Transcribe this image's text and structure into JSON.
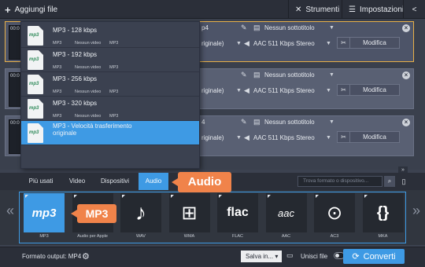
{
  "toolbar": {
    "add_files": "Aggiungi file",
    "tools": "Strumenti",
    "settings": "Impostazioni"
  },
  "files": [
    {
      "video": "p4",
      "subtitle": "Nessun sottotitolo",
      "audio_prefix": "riginale)",
      "audio": "AAC 511 Kbps Stereo",
      "edit": "Modifica"
    },
    {
      "video": "",
      "subtitle": "Nessun sottotitolo",
      "audio_prefix": "riginale)",
      "audio": "AAC 511 Kbps Stereo",
      "edit": "Modifica"
    },
    {
      "video": "4",
      "subtitle": "Nessun sottotitolo",
      "audio_prefix": "riginale)",
      "audio": "AAC 511 Kbps Stereo",
      "edit": "Modifica"
    }
  ],
  "thumb_time": "00:0",
  "dropdown": [
    {
      "title": "MP3 - 128 kbps",
      "ext": "MP3",
      "video": "Nessun video",
      "codec": "MP3",
      "icon": "mp3"
    },
    {
      "title": "MP3 - 192 kbps",
      "ext": "MP3",
      "video": "Nessun video",
      "codec": "MP3",
      "icon": "mp3"
    },
    {
      "title": "MP3 - 256 kbps",
      "ext": "MP3",
      "video": "Nessun video",
      "codec": "MP3",
      "icon": "mp3"
    },
    {
      "title": "MP3 - 320 kbps",
      "ext": "MP3",
      "video": "Nessun video",
      "codec": "MP3",
      "icon": "mp3"
    },
    {
      "title": "MP3 - Velocità trasferimento originale",
      "ext": "MP3",
      "video": "Nessun video",
      "codec": "MP3",
      "icon": "mp3",
      "active": true
    }
  ],
  "tabs": [
    "Più usati",
    "Video",
    "Dispositivi",
    "Audio"
  ],
  "search_placeholder": "Trova formato o dispositivo...",
  "callouts": {
    "audio": "Audio",
    "mp3": "MP3"
  },
  "formats": [
    {
      "label": "MP3",
      "icon": "mp3-logo",
      "active": true
    },
    {
      "label": "Audio per Apple",
      "icon": "apple-logo"
    },
    {
      "label": "WAV",
      "icon": "music-note"
    },
    {
      "label": "WMA",
      "icon": "windows-logo"
    },
    {
      "label": "FLAC",
      "icon": "flac-logo"
    },
    {
      "label": "AAC",
      "icon": "aac-logo"
    },
    {
      "label": "AC3",
      "icon": "play-circle"
    },
    {
      "label": "MKA",
      "icon": "matroska-logo"
    }
  ],
  "bottom": {
    "output_format": "Formato output: MP4",
    "save_in": "Salva in...",
    "merge": "Unisci file",
    "convert": "Converti"
  },
  "colors": {
    "accent": "#3e9ae4",
    "callout": "#f0834a",
    "selection": "#e8b048"
  }
}
